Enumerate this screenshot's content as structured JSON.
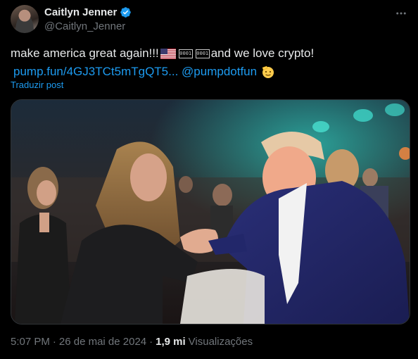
{
  "author": {
    "display_name": "Caitlyn Jenner",
    "handle": "@Caitlyn_Jenner",
    "verified": true
  },
  "post": {
    "text_part1": "make america great again!!! ",
    "text_part2": "and we love crypto!",
    "link_url": "pump.fun/4GJ3TCt5mTgQT5...",
    "mention": "@pumpdotfun",
    "glyph_1": "0001",
    "glyph_2": "0001",
    "translate_label": "Traduzir post"
  },
  "meta": {
    "time": "5:07 PM",
    "sep1": "·",
    "date": "26 de mai de 2024",
    "sep2": "·",
    "views_count": "1,9 mi",
    "views_label": "Visualizações"
  },
  "icons": {
    "more": "more-horizontal-icon",
    "verified": "verified-badge-icon",
    "flag": "us-flag-emoji",
    "face": "saluting-face-emoji"
  },
  "colors": {
    "background": "#000000",
    "text": "#e7e9ea",
    "secondary": "#71767b",
    "link": "#1d9bf0",
    "border": "#2f3336"
  }
}
